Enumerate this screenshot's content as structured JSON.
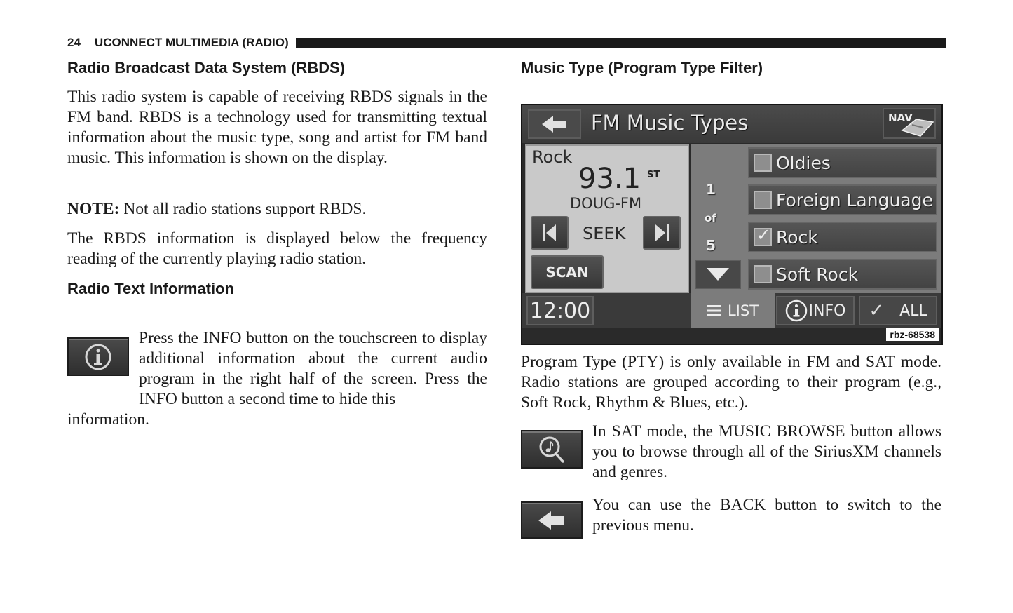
{
  "header": {
    "page_number": "24",
    "section": "UCONNECT MULTIMEDIA (RADIO)"
  },
  "left": {
    "rbds_heading": "Radio Broadcast Data System (RBDS)",
    "rbds_paragraph": "This radio system is capable of receiving RBDS signals in the FM band. RBDS is a technology used for transmitting textual information about the music type, song and artist for FM band music. This information is shown on the display.",
    "note_label": "NOTE:",
    "note_text": " Not all radio stations support RBDS.",
    "rbds_display_paragraph": "The RBDS information is displayed below the frequency reading of the currently playing radio station.",
    "radio_text_heading": "Radio Text Information",
    "info_icon": "info-icon",
    "info_paragraph_part1": "Press the INFO button on the touchscreen to display additional information about the current audio program in the right half of the screen. Press the INFO button a second time to hide this",
    "info_paragraph_part2": "information."
  },
  "right": {
    "music_type_heading": "Music Type (Program Type Filter)",
    "screen": {
      "title": "FM Music Types",
      "back_icon": "back-arrow-icon",
      "nav_label": "NAV",
      "program_type": "Rock",
      "frequency": "93.1",
      "stereo": "ST",
      "station": "DOUG-FM",
      "seek_label": "SEEK",
      "scan_label": "SCAN",
      "pager_current": "1",
      "pager_of": "of",
      "pager_total": "5",
      "music_types": [
        {
          "label": "Oldies",
          "checked": false
        },
        {
          "label": "Foreign Language",
          "checked": false
        },
        {
          "label": "Rock",
          "checked": true
        },
        {
          "label": "Soft Rock",
          "checked": false
        }
      ],
      "clock": "12:00",
      "list_label": "LIST",
      "info_label": "INFO",
      "all_label": "ALL",
      "figure_code": "rbz-68538"
    },
    "pty_paragraph": "Program Type (PTY) is only available in FM and SAT mode. Radio stations are grouped according to their program (e.g., Soft Rock, Rhythm & Blues, etc.).",
    "music_browse_icon": "music-browse-icon",
    "music_browse_paragraph": "In SAT mode, the MUSIC BROWSE button allows you to browse through all of the SiriusXM channels and genres.",
    "back_icon": "back-arrow-icon",
    "back_paragraph": "You can use the BACK button to switch to the previous menu."
  }
}
